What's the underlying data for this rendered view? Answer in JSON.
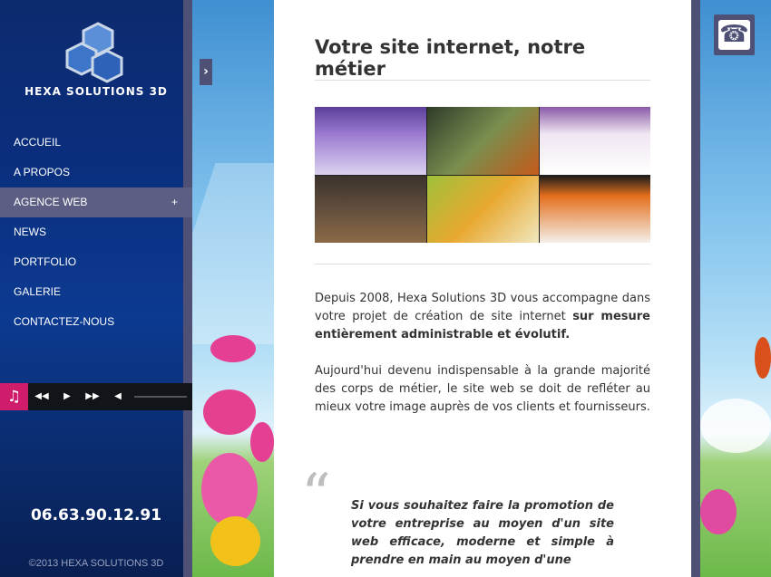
{
  "logo": {
    "text": "HEXA SOLUTIONS 3D"
  },
  "nav": {
    "items": [
      {
        "label": "ACCUEIL"
      },
      {
        "label": "A PROPOS"
      },
      {
        "label": "AGENCE WEB",
        "expand": "+"
      },
      {
        "label": "NEWS"
      },
      {
        "label": "PORTFOLIO"
      },
      {
        "label": "GALERIE"
      },
      {
        "label": "CONTACTEZ-NOUS"
      }
    ],
    "active": "AGENCE WEB"
  },
  "player": {
    "music": "♫",
    "prev": "◀◀",
    "play": "▶",
    "next": "▶▶",
    "volume": "◀"
  },
  "contact": {
    "phone": "06.63.90.12.91"
  },
  "footer": {
    "copyright": "©2013 HEXA SOLUTIONS 3D"
  },
  "toggle": {
    "label": "›"
  },
  "content": {
    "title": "Votre site internet, notre métier",
    "para1_a": "Depuis 2008, Hexa Solutions 3D vous accompagne dans votre projet de création de site internet ",
    "para1_b": "sur mesure entièrement administrable et évolutif.",
    "para2": "Aujourd'hui devenu indispensable à la grande majorité des corps de métier, le site web se doit de refléter au mieux votre image auprès de vos clients et fournisseurs.",
    "quote_mark": "“",
    "quote": "Si vous souhaitez faire la promotion de votre entreprise au moyen d'un site web efficace, moderne et simple à prendre en main au moyen d'une"
  },
  "phone_button": {
    "icon": "☎"
  },
  "colors": {
    "sidebar": "#0a2f7f",
    "accent": "#cf1d6b",
    "frame": "#4f5076"
  }
}
